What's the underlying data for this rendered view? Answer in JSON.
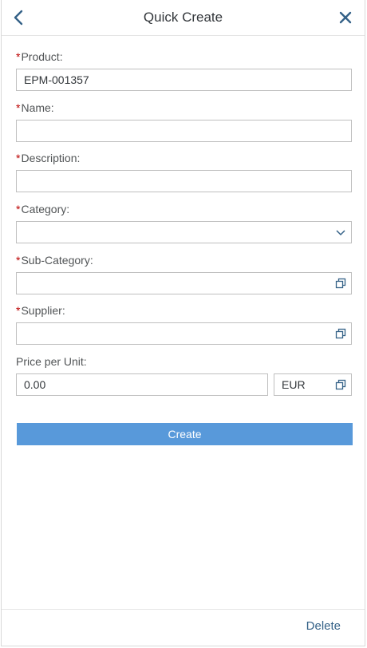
{
  "header": {
    "title": "Quick Create"
  },
  "form": {
    "product": {
      "label": "Product:",
      "required": "*",
      "value": "EPM-001357"
    },
    "name": {
      "label": "Name:",
      "required": "*",
      "value": ""
    },
    "description": {
      "label": "Description:",
      "required": "*",
      "value": ""
    },
    "category": {
      "label": "Category:",
      "required": "*",
      "value": ""
    },
    "sub_category": {
      "label": "Sub-Category:",
      "required": "*",
      "value": ""
    },
    "supplier": {
      "label": "Supplier:",
      "required": "*",
      "value": ""
    },
    "price": {
      "label": "Price per Unit:",
      "amount": "0.00",
      "currency": "EUR"
    }
  },
  "actions": {
    "create_label": "Create",
    "delete_label": "Delete"
  },
  "icons": {
    "back": "chevron-left-icon",
    "close": "close-icon",
    "dropdown": "chevron-down-icon",
    "value_help": "value-help-icon"
  },
  "colors": {
    "accent": "#346187",
    "button": "#5899da",
    "required": "#bb0000"
  }
}
